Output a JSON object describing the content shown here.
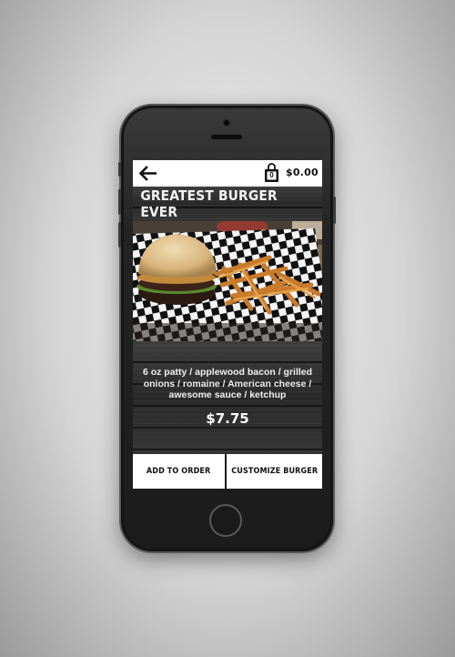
{
  "header": {
    "cart_count": "0",
    "cart_total": "$0.00",
    "back_icon": "arrow-left-icon",
    "cart_icon": "shopping-bag-icon"
  },
  "item": {
    "title": "GREATEST BURGER EVER",
    "description": "6 oz patty / applewood bacon / grilled onions / romaine / American cheese / awesome sauce / ketchup",
    "price": "$7.75"
  },
  "actions": {
    "add_label": "ADD TO ORDER",
    "customize_label": "CUSTOMIZE BURGER"
  },
  "colors": {
    "background": "#1b1b1b",
    "button_bg": "#ffffff",
    "text_light": "#f2f2f2"
  }
}
